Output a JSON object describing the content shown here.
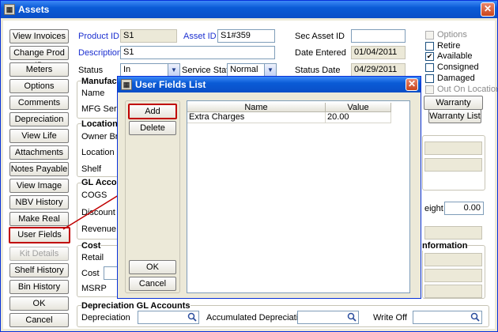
{
  "window": {
    "title": "Assets",
    "close": "✕"
  },
  "side_buttons": [
    {
      "label": "View Invoices"
    },
    {
      "label": "Change Prod ID"
    },
    {
      "label": "Meters"
    },
    {
      "label": "Options"
    },
    {
      "label": "Comments"
    },
    {
      "label": "Depreciation"
    },
    {
      "label": "View Life"
    },
    {
      "label": "Attachments"
    },
    {
      "label": "Notes Payable"
    },
    {
      "label": "View Image"
    },
    {
      "label": "NBV History"
    },
    {
      "label": "Make Real"
    },
    {
      "label": "User Fields"
    },
    {
      "label": "Kit Details"
    },
    {
      "label": "Shelf History"
    },
    {
      "label": "Bin History"
    },
    {
      "label": "OK"
    },
    {
      "label": "Cancel"
    }
  ],
  "form": {
    "product_id_label": "Product ID",
    "product_id": "S1",
    "asset_id_label": "Asset ID",
    "asset_id": "S1#359",
    "sec_asset_id_label": "Sec Asset ID",
    "sec_asset_id": "",
    "description_label": "Description",
    "description": "S1",
    "date_entered_label": "Date Entered",
    "date_entered": "01/04/2011",
    "status_label": "Status",
    "status": "In",
    "service_status_label": "Service Status",
    "service_status": "Normal",
    "status_date_label": "Status Date",
    "status_date": "04/29/2011",
    "manufacturer_group": "Manufactur",
    "name_label": "Name",
    "mfg_serial_label": "MFG Serial",
    "location_group": "Location",
    "owner_branch_label": "Owner Bran",
    "location_label": "Location",
    "shelf_label": "Shelf",
    "gl_group": "GL Account",
    "cogs_label": "COGS",
    "discount_label": "Discount",
    "revenue_label": "Revenue",
    "cost_group": "Cost",
    "retail_label": "Retail",
    "cost_label": "Cost",
    "msrp_label": "MSRP",
    "weight_label": "eight",
    "weight": "0.00",
    "info_group": "nformation",
    "dep_gl_group": "Depreciation GL Accounts",
    "depreciation_label": "Depreciation",
    "accum_dep_label": "Accumulated Depreciation",
    "write_off_label": "Write Off"
  },
  "checks": [
    {
      "label": "Options",
      "checked": false,
      "disabled": true
    },
    {
      "label": "Retire",
      "checked": false,
      "disabled": false
    },
    {
      "label": "Available",
      "checked": true,
      "disabled": false
    },
    {
      "label": "Consigned",
      "checked": false,
      "disabled": false
    },
    {
      "label": "Damaged",
      "checked": false,
      "disabled": false
    },
    {
      "label": "Out On Location",
      "checked": false,
      "disabled": true
    }
  ],
  "right_buttons": {
    "warranty_actuation": "Warranty Actuation",
    "warranty_list": "Warranty List"
  },
  "dialog": {
    "title": "User Fields List",
    "add": "Add",
    "delete": "Delete",
    "ok": "OK",
    "cancel": "Cancel",
    "columns": [
      "Name",
      "Value"
    ],
    "rows": [
      {
        "name": "Extra Charges",
        "value": "20.00"
      }
    ]
  },
  "colors": {
    "accent": "#1b2fd0",
    "highlight": "#c00000",
    "titlebar": "#0a5bd6"
  }
}
